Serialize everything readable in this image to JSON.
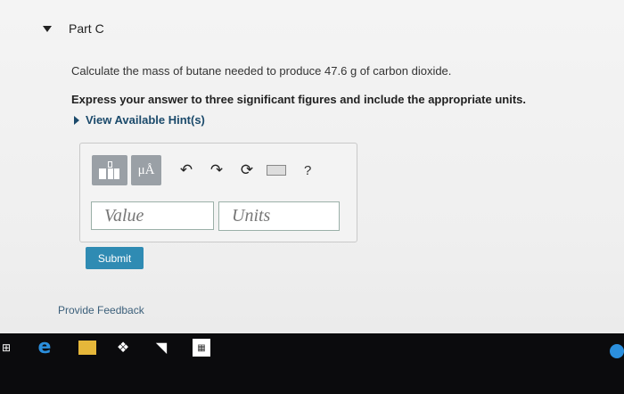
{
  "part": {
    "title": "Part C"
  },
  "question": {
    "prompt": "Calculate the mass of butane needed to produce 47.6 g of carbon dioxide.",
    "instruction": "Express your answer to three significant figures and include the appropriate units."
  },
  "hint": {
    "label": "View Available Hint(s)"
  },
  "toolbar": {
    "units_button_label": "μÅ",
    "help_label": "?",
    "undo_icon": "undo-icon",
    "redo_icon": "redo-icon",
    "reset_icon": "reset-icon",
    "keyboard_icon": "keyboard-icon"
  },
  "answer": {
    "value_placeholder": "Value",
    "units_placeholder": "Units"
  },
  "actions": {
    "submit_label": "Submit"
  },
  "feedback": {
    "label": "Provide Feedback"
  },
  "taskbar": {
    "items": [
      "task-view-icon",
      "edge-icon",
      "file-explorer-icon",
      "dropbox-icon",
      "visual-studio-icon",
      "store-icon"
    ]
  },
  "colors": {
    "submit_bg": "#2f8bb3",
    "hint_color": "#1b4a6b",
    "toolbar_button": "#9aa0a6",
    "taskbar_bg": "#0b0b0d"
  }
}
